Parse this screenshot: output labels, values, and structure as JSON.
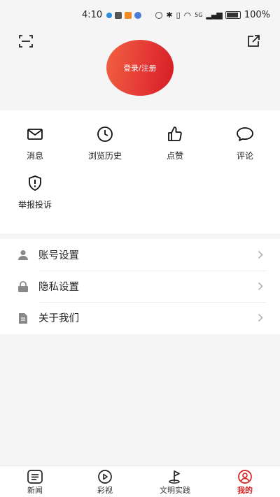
{
  "status_bar": {
    "time": "4:10",
    "battery": "100%",
    "network": "5G"
  },
  "header": {
    "login_label": "登录/注册"
  },
  "grid": {
    "items": [
      {
        "label": "消息",
        "icon": "mail-icon"
      },
      {
        "label": "浏览历史",
        "icon": "clock-icon"
      },
      {
        "label": "点赞",
        "icon": "thumbs-up-icon"
      },
      {
        "label": "评论",
        "icon": "comment-icon"
      },
      {
        "label": "举报投诉",
        "icon": "report-shield-icon"
      }
    ]
  },
  "settings": {
    "items": [
      {
        "label": "账号设置",
        "icon": "person-icon"
      },
      {
        "label": "隐私设置",
        "icon": "lock-icon"
      },
      {
        "label": "关于我们",
        "icon": "document-icon"
      }
    ]
  },
  "tabbar": {
    "tabs": [
      {
        "label": "新闻",
        "icon": "news-icon"
      },
      {
        "label": "彩视",
        "icon": "play-icon"
      },
      {
        "label": "文明实践",
        "icon": "flag-icon"
      },
      {
        "label": "我的",
        "icon": "profile-icon",
        "active": true
      }
    ],
    "active_color": "#d81e1e"
  },
  "colors": {
    "accent": "#d81e1e",
    "login_gradient_start": "#f16140",
    "login_gradient_end": "#d61c25"
  }
}
